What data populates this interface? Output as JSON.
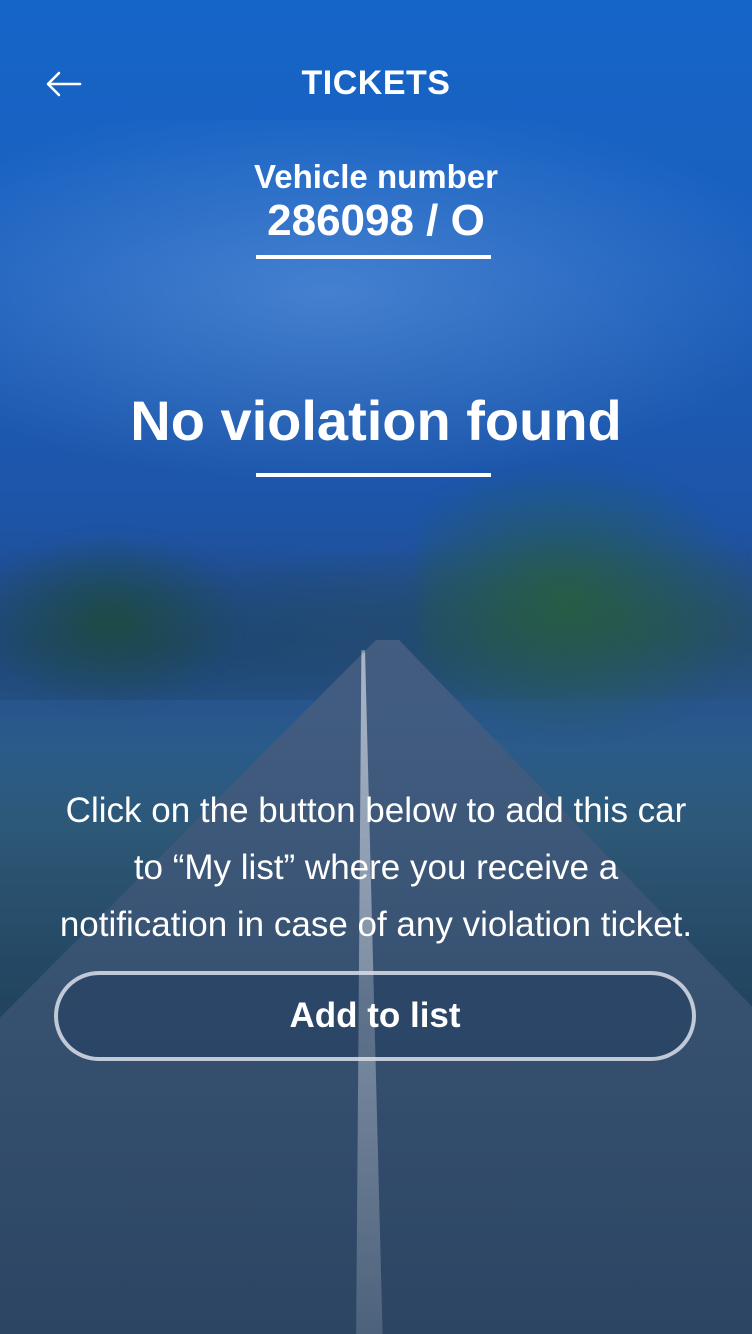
{
  "header": {
    "title": "TICKETS",
    "back_icon": "arrow-left-icon"
  },
  "vehicle": {
    "label": "Vehicle number",
    "number": "286098 / O"
  },
  "result": {
    "status": "No violation found"
  },
  "info": {
    "line1": "Click on the button below to add this car",
    "line2": "to “My list” where you receive a",
    "line3": "notification in case of any violation ticket."
  },
  "actions": {
    "add_label": "Add to list"
  },
  "colors": {
    "text": "#ffffff",
    "background_top": "#1565c8",
    "button_border": "#dce1eb"
  }
}
